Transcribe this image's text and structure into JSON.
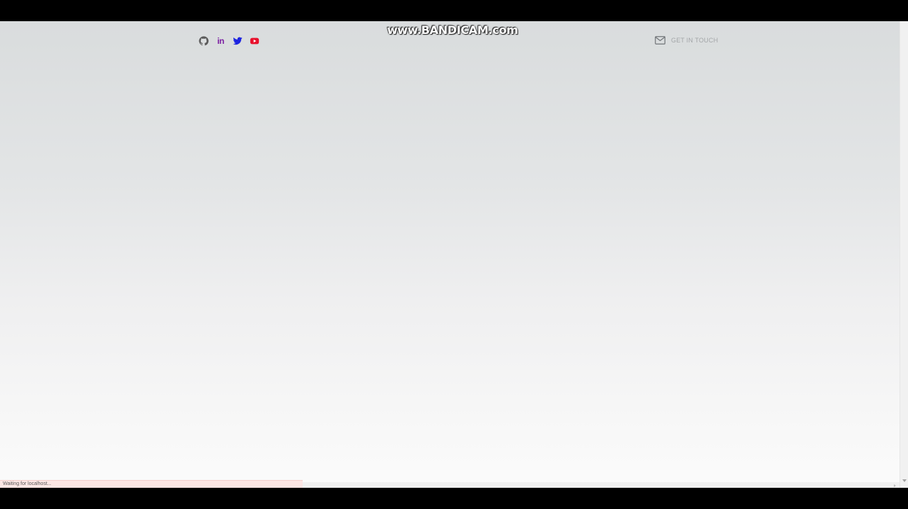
{
  "recording_watermark": "www.BANDICAM.com",
  "header": {
    "social_links": [
      {
        "name": "github",
        "icon": "github-icon",
        "color": "#555555"
      },
      {
        "name": "linkedin",
        "icon": "linkedin-icon",
        "label": "in",
        "color": "#7b1fa2"
      },
      {
        "name": "twitter",
        "icon": "twitter-icon",
        "color": "#1d24e0"
      },
      {
        "name": "youtube",
        "icon": "youtube-icon",
        "color": "#e8112d"
      }
    ],
    "contact": {
      "icon": "mail-icon",
      "label": "GET IN TOUCH"
    }
  },
  "status_bar": {
    "text": "Waiting for localhost..."
  },
  "colors": {
    "page_bg_top": "#d9dcdd",
    "page_bg_bottom": "#fbfbfb",
    "status_bg": "#fce6e4",
    "contact_text": "#a3a6a8"
  }
}
